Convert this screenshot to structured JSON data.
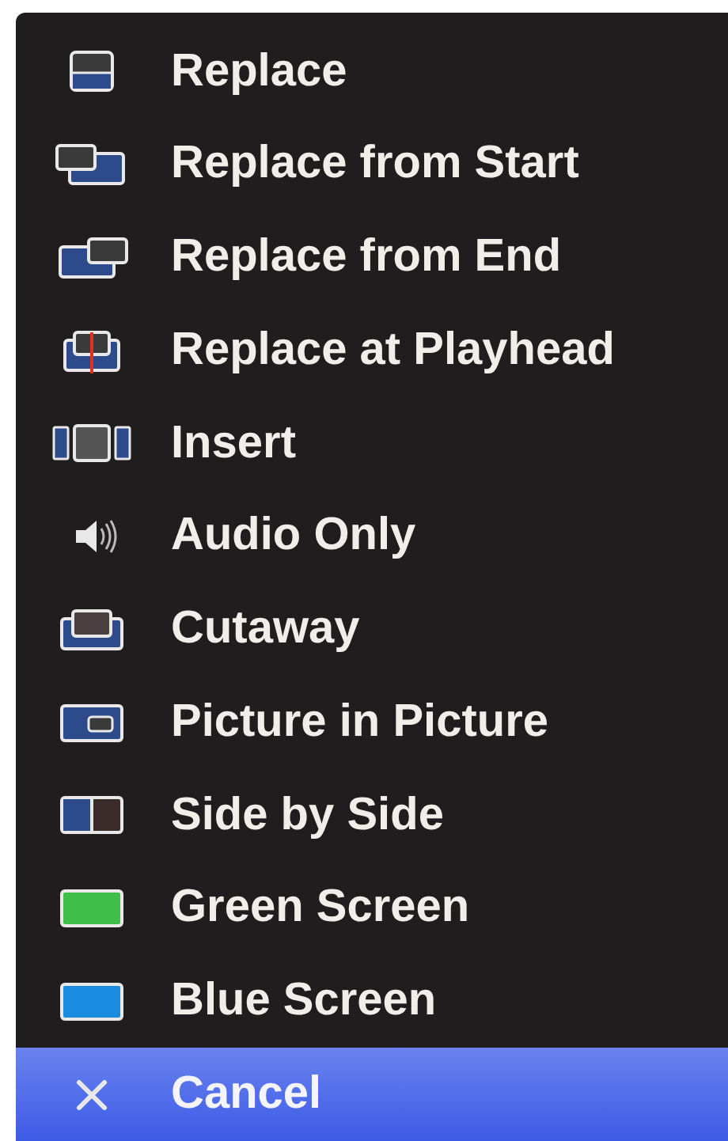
{
  "menu": {
    "items": [
      {
        "kind": "replace",
        "label": "Replace",
        "selected": false
      },
      {
        "kind": "replace-start",
        "label": "Replace from Start",
        "selected": false
      },
      {
        "kind": "replace-end",
        "label": "Replace from End",
        "selected": false
      },
      {
        "kind": "replace-playhead",
        "label": "Replace at Playhead",
        "selected": false
      },
      {
        "kind": "insert",
        "label": "Insert",
        "selected": false
      },
      {
        "kind": "audio",
        "label": "Audio Only",
        "selected": false
      },
      {
        "kind": "cutaway",
        "label": "Cutaway",
        "selected": false
      },
      {
        "kind": "pip",
        "label": "Picture in Picture",
        "selected": false
      },
      {
        "kind": "side",
        "label": "Side by Side",
        "selected": false
      },
      {
        "kind": "green",
        "label": "Green Screen",
        "selected": false
      },
      {
        "kind": "blue",
        "label": "Blue Screen",
        "selected": false
      },
      {
        "kind": "cancel",
        "label": "Cancel",
        "selected": true
      }
    ]
  }
}
